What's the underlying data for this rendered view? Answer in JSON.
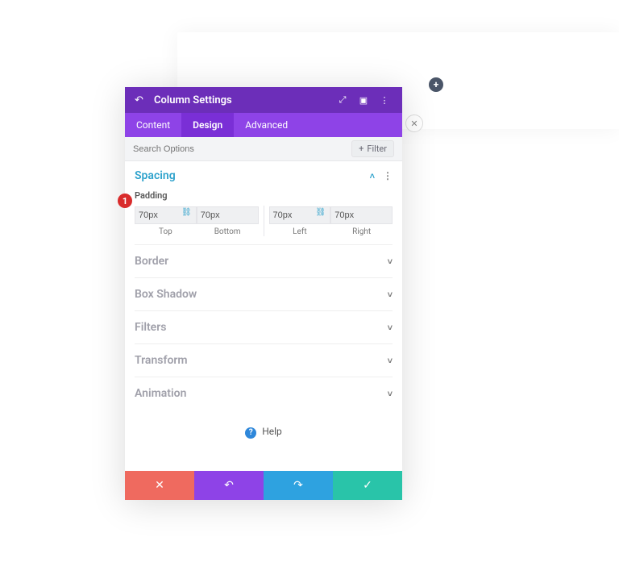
{
  "canvas": {
    "add_glyph": "+",
    "close_glyph": "✕"
  },
  "header": {
    "back_glyph": "↶",
    "title": "Column Settings",
    "expand_glyph": "⤢",
    "layout_glyph": "▣",
    "menu_glyph": "⋮"
  },
  "tabs": {
    "content": "Content",
    "design": "Design",
    "advanced": "Advanced"
  },
  "search": {
    "placeholder": "Search Options",
    "filter_plus": "+",
    "filter_label": "Filter"
  },
  "spacing": {
    "title": "Spacing",
    "caret": "˄",
    "dots": "⋮",
    "padding_label": "Padding",
    "link_glyph": "⛓",
    "pads": {
      "top": {
        "value": "70px",
        "label": "Top"
      },
      "bottom": {
        "value": "70px",
        "label": "Bottom"
      },
      "left": {
        "value": "70px",
        "label": "Left"
      },
      "right": {
        "value": "70px",
        "label": "Right"
      }
    }
  },
  "sections": {
    "border": "Border",
    "box_shadow": "Box Shadow",
    "filters": "Filters",
    "transform": "Transform",
    "animation": "Animation",
    "caret": "˅"
  },
  "help": {
    "glyph": "?",
    "label": "Help"
  },
  "footer": {
    "cancel": "✕",
    "undo": "↶",
    "redo": "↷",
    "ok": "✓"
  },
  "marker": {
    "num": "1"
  }
}
